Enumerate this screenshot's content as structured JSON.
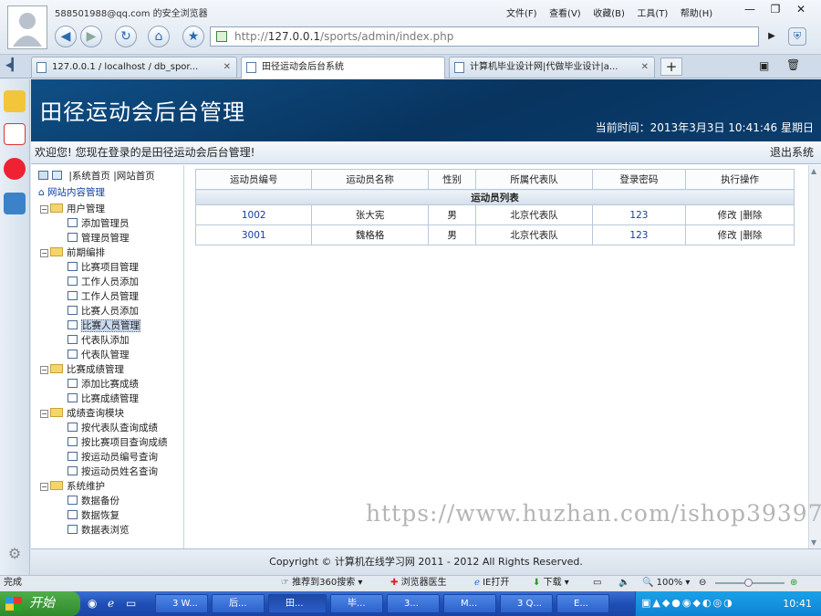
{
  "browser": {
    "account": "588501988@qq.com 的安全浏览器",
    "menu": [
      "文件(F)",
      "查看(V)",
      "收藏(B)",
      "工具(T)",
      "帮助(H)"
    ],
    "address_prefix": "http://",
    "address_host": "127.0.0.1",
    "address_path": "/sports/admin/index.php",
    "tabs": [
      {
        "label": "127.0.0.1 / localhost / db_spor..."
      },
      {
        "label": "田径运动会后台系统"
      },
      {
        "label": "计算机毕业设计网|代做毕业设计|a..."
      }
    ]
  },
  "page": {
    "title": "田径运动会后台管理",
    "time": "当前时间：2013年3月3日 10:41:46 星期日",
    "welcome": "欢迎您! 您现在登录的是田径运动会后台管理!",
    "logout": "退出系统",
    "top_links": [
      "|系统首页",
      "|网站首页"
    ],
    "nav_root": "网站内容管理",
    "nav": [
      {
        "group": "用户管理",
        "items": [
          "添加管理员",
          "管理员管理"
        ]
      },
      {
        "group": "前期编排",
        "items": [
          "比赛项目管理",
          "工作人员添加",
          "工作人员管理",
          "比赛人员添加",
          "比赛人员管理",
          "代表队添加",
          "代表队管理"
        ]
      },
      {
        "group": "比赛成绩管理",
        "items": [
          "添加比赛成绩",
          "比赛成绩管理"
        ]
      },
      {
        "group": "成绩查询模块",
        "items": [
          "按代表队查询成绩",
          "按比赛项目查询成绩",
          "按运动员编号查询",
          "按运动员姓名查询"
        ]
      },
      {
        "group": "系统维护",
        "items": [
          "数据备份",
          "数据恢复",
          "数据表浏览"
        ]
      }
    ],
    "table": {
      "caption": "运动员列表",
      "headers": [
        "运动员编号",
        "运动员名称",
        "性别",
        "所属代表队",
        "登录密码",
        "执行操作"
      ],
      "rows": [
        {
          "id": "1002",
          "name": "张大宪",
          "sex": "男",
          "team": "北京代表队",
          "pwd": "123"
        },
        {
          "id": "3001",
          "name": "魏格格",
          "sex": "男",
          "team": "北京代表队",
          "pwd": "123"
        }
      ],
      "edit": "修改",
      "del": "|删除"
    },
    "footer": "Copyright © 计算机在线学习网 2011 - 2012 All Rights Reserved.",
    "watermark": "https://www.huzhan.com/ishop39397"
  },
  "status": {
    "left": "完成",
    "items": [
      "推荐到360搜索",
      "浏览器医生",
      "IE打开",
      "下载",
      "100%"
    ]
  },
  "taskbar": {
    "start": "开始",
    "buttons": [
      "3 W...",
      "后...",
      "田...",
      "毕...",
      "3...",
      "M...",
      "3 Q...",
      "E..."
    ],
    "clock": "10:41"
  }
}
